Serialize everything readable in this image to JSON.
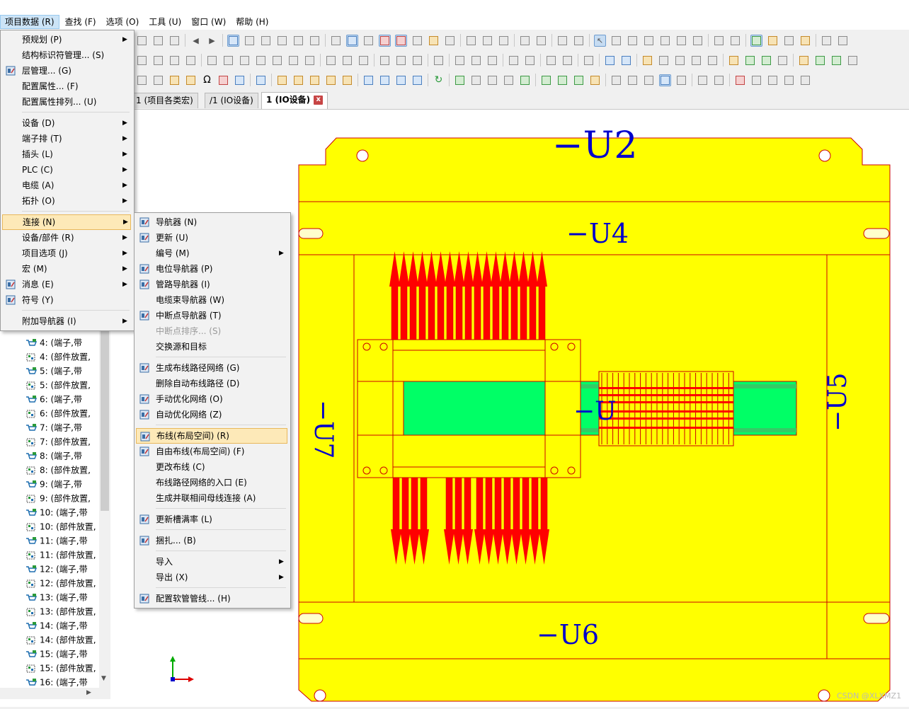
{
  "menubar": {
    "items": [
      "项目数据 (R)",
      "查找 (F)",
      "选项 (O)",
      "工具 (U)",
      "窗口 (W)",
      "帮助 (H)"
    ]
  },
  "tabs": [
    {
      "label": "1 (项目各类宏)"
    },
    {
      "label": "/1 (IO设备)"
    },
    {
      "label": "1 (IO设备)",
      "active": true,
      "close": "x"
    }
  ],
  "tree": {
    "items": [
      "4: (端子,带",
      "4: (部件放置,",
      "5: (端子,带",
      "5: (部件放置,",
      "6: (端子,带",
      "6: (部件放置,",
      "7: (端子,带",
      "7: (部件放置,",
      "8: (端子,带",
      "8: (部件放置,",
      "9: (端子,带",
      "9: (部件放置,",
      "10: (端子,带",
      "10: (部件放置,",
      "11: (端子,带",
      "11: (部件放置,",
      "12: (端子,带",
      "12: (部件放置,",
      "13: (端子,带",
      "13: (部件放置,",
      "14: (端子,带",
      "14: (部件放置,",
      "15: (端子,带",
      "15: (部件放置,",
      "16: (端子,带"
    ]
  },
  "menu1": {
    "items": [
      {
        "label": "预规划 (P)",
        "submenu": true
      },
      {
        "label": "结构标识符管理... (S)"
      },
      {
        "label": "层管理... (G)",
        "icon": "layer-icon"
      },
      {
        "label": "配置属性... (F)"
      },
      {
        "label": "配置属性排列... (U)"
      },
      {
        "label": "设备 (D)",
        "submenu": true
      },
      {
        "label": "端子排 (T)",
        "submenu": true
      },
      {
        "label": "插头 (L)",
        "submenu": true
      },
      {
        "label": "PLC (C)",
        "submenu": true
      },
      {
        "label": "电缆 (A)",
        "submenu": true
      },
      {
        "label": "拓扑 (O)",
        "submenu": true
      },
      {
        "label": "连接 (N)",
        "submenu": true,
        "highlight": true
      },
      {
        "label": "设备/部件 (R)",
        "submenu": true
      },
      {
        "label": "项目选项 (J)",
        "submenu": true
      },
      {
        "label": "宏 (M)",
        "submenu": true
      },
      {
        "label": "消息 (E)",
        "submenu": true,
        "icon": "message-icon"
      },
      {
        "label": "符号 (Y)",
        "icon": "symbol-icon"
      },
      {
        "label": "附加导航器 (I)",
        "submenu": true
      }
    ]
  },
  "menu2": {
    "items": [
      {
        "label": "导航器 (N)",
        "icon": "navigator-icon"
      },
      {
        "label": "更新 (U)",
        "icon": "update-icon"
      },
      {
        "label": "编号 (M)",
        "submenu": true
      },
      {
        "label": "电位导航器 (P)",
        "icon": "potential-navigator-icon"
      },
      {
        "label": "管路导航器 (I)",
        "icon": "pipe-navigator-icon"
      },
      {
        "label": "电缆束导航器 (W)"
      },
      {
        "label": "中断点导航器 (T)",
        "icon": "interruption-navigator-icon"
      },
      {
        "label": "中断点排序... (S)",
        "disabled": true
      },
      {
        "label": "交换源和目标"
      },
      {
        "label": "生成布线路径网络 (G)",
        "icon": "generate-routing-icon"
      },
      {
        "label": "删除自动布线路径 (D)"
      },
      {
        "label": "手动优化网络 (O)",
        "icon": "manual-optimize-icon"
      },
      {
        "label": "自动优化网络 (Z)",
        "icon": "auto-optimize-icon"
      },
      {
        "label": "布线(布局空间) (R)",
        "icon": "routing-icon",
        "highlight": true
      },
      {
        "label": "自由布线(布局空间) (F)",
        "icon": "free-routing-icon"
      },
      {
        "label": "更改布线 (C)"
      },
      {
        "label": "布线路径网络的入口 (E)"
      },
      {
        "label": "生成并联相间母线连接 (A)"
      },
      {
        "label": "更新槽满率 (L)",
        "icon": "fill-rate-icon"
      },
      {
        "label": "捆扎... (B)",
        "icon": "bundle-icon"
      },
      {
        "label": "导入",
        "submenu": true
      },
      {
        "label": "导出 (X)",
        "submenu": true
      },
      {
        "label": "配置软管管线... (H)",
        "icon": "hose-icon"
      }
    ]
  },
  "canvas": {
    "labels": {
      "u2": "−U2",
      "u4": "−U4",
      "u6": "−U6",
      "u7": "−U7",
      "u5": "−U5",
      "u3": "−U"
    },
    "colors": {
      "plate": "#ffff00",
      "outline": "#cc0000",
      "wires": "#ff0000",
      "rail": "#00ff66",
      "rail_dark": "#00c060",
      "label": "#0000cc"
    }
  },
  "watermark": "CSDN @XLXMZ1"
}
